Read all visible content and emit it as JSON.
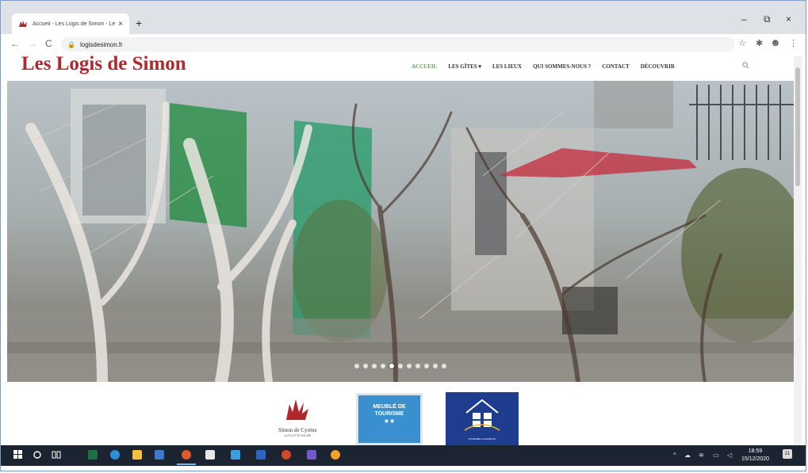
{
  "browser": {
    "tab_title": "Accueil - Les Logis de Simon - Le",
    "tab_close": "×",
    "new_tab": "+",
    "url": "logisdesimon.fr",
    "window_controls": {
      "minimize": "–",
      "maximize": "⧉",
      "close": "×"
    }
  },
  "site": {
    "logo": "Les Logis de Simon",
    "menu": [
      {
        "label": "ACCUEIL",
        "active": true
      },
      {
        "label": "LES GÎTES ▾",
        "active": false
      },
      {
        "label": "LES LIEUX",
        "active": false
      },
      {
        "label": "QUI SOMMES-NOUS ?",
        "active": false
      },
      {
        "label": "CONTACT",
        "active": false
      },
      {
        "label": "DÉCOUVRIR",
        "active": false
      }
    ],
    "slider": {
      "slides": 11,
      "active_index": 4
    }
  },
  "badges": {
    "simon": {
      "name": "Simon de Cyrène",
      "sub": "LA FLOTTE EN RÉ"
    },
    "meuble": {
      "title": "MEUBLÉ DE TOURISME",
      "stars": "★★"
    },
    "tourisme": {
      "caption": "TOURISME & HANDICAP"
    }
  },
  "taskbar": {
    "clock_time": "18:59",
    "clock_date": "15/12/2020",
    "notifications": "21"
  },
  "colors": {
    "logo": "#b0282c",
    "menu_active": "#55a85a",
    "taskbar": "#1b2430"
  }
}
